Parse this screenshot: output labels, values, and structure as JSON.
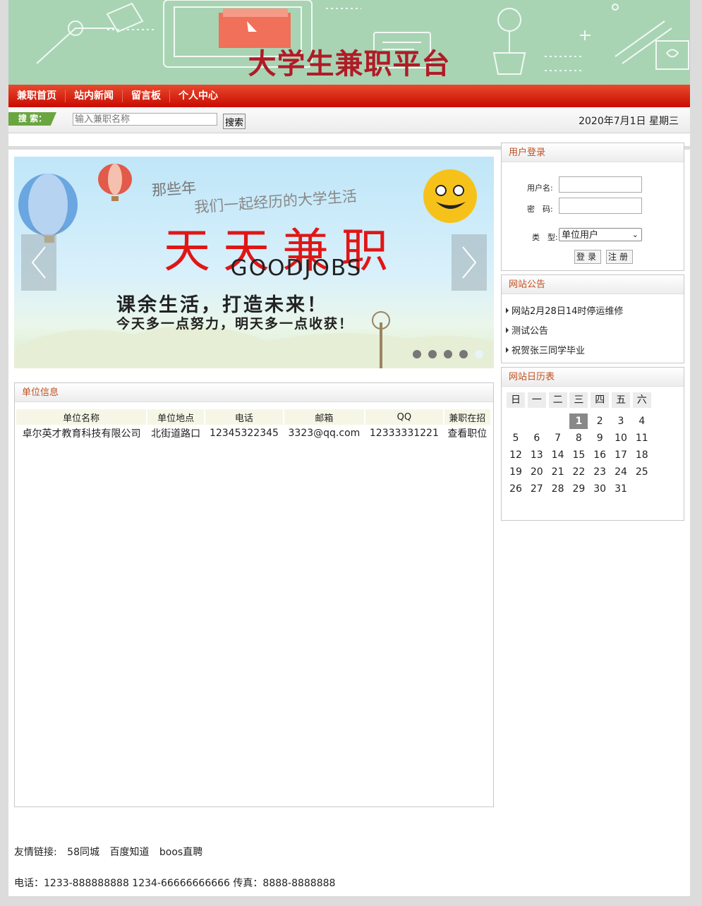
{
  "header": {
    "title": "大学生兼职平台"
  },
  "nav": {
    "items": [
      "兼职首页",
      "站内新闻",
      "留言板",
      "个人中心"
    ]
  },
  "search": {
    "tag_label": "搜 索：",
    "placeholder": "输入兼职名称",
    "button_label": "搜索",
    "date_text": "2020年7月1日 星期三"
  },
  "slider": {
    "subtitle_1": "那些年",
    "subtitle_2": "我们一起经历的大学生活",
    "headline": "天天兼职",
    "english": "GOODJOBS",
    "slogan_1": "课余生活，打造未来！",
    "slogan_2": "今天多一点努力，明天多一点收获！",
    "dot_count": 5,
    "active_dot": 4
  },
  "company": {
    "title": "单位信息",
    "columns": [
      "单位名称",
      "单位地点",
      "电话",
      "邮箱",
      "QQ",
      "兼职在招"
    ],
    "rows": [
      [
        "卓尔英才教育科技有限公司",
        "北街道路口",
        "12345322345",
        "3323@qq.com",
        "12333331221",
        "查看职位"
      ]
    ]
  },
  "login": {
    "title": "用户登录",
    "username_label": "用户名:",
    "password_label": "密　码:",
    "type_label": "类　型:",
    "type_value": "单位用户",
    "login_button": "登录",
    "register_button": "注册"
  },
  "notice": {
    "title": "网站公告",
    "items": [
      "网站2月28日14时停运维修",
      "测试公告",
      "祝贺张三同学毕业"
    ]
  },
  "calendar": {
    "title": "网站日历表",
    "weekdays": [
      "日",
      "一",
      "二",
      "三",
      "四",
      "五",
      "六"
    ],
    "weeks": [
      [
        "",
        "",
        "",
        "1",
        "2",
        "3",
        "4"
      ],
      [
        "5",
        "6",
        "7",
        "8",
        "9",
        "10",
        "11"
      ],
      [
        "12",
        "13",
        "14",
        "15",
        "16",
        "17",
        "18"
      ],
      [
        "19",
        "20",
        "21",
        "22",
        "23",
        "24",
        "25"
      ],
      [
        "26",
        "27",
        "28",
        "29",
        "30",
        "31",
        ""
      ]
    ],
    "today": "1"
  },
  "footer": {
    "links_label": "友情链接:",
    "links": [
      "58同城",
      "百度知道",
      "boos直聘"
    ],
    "contact": "电话：1233-888888888 1234-66666666666 传真：8888-8888888"
  }
}
